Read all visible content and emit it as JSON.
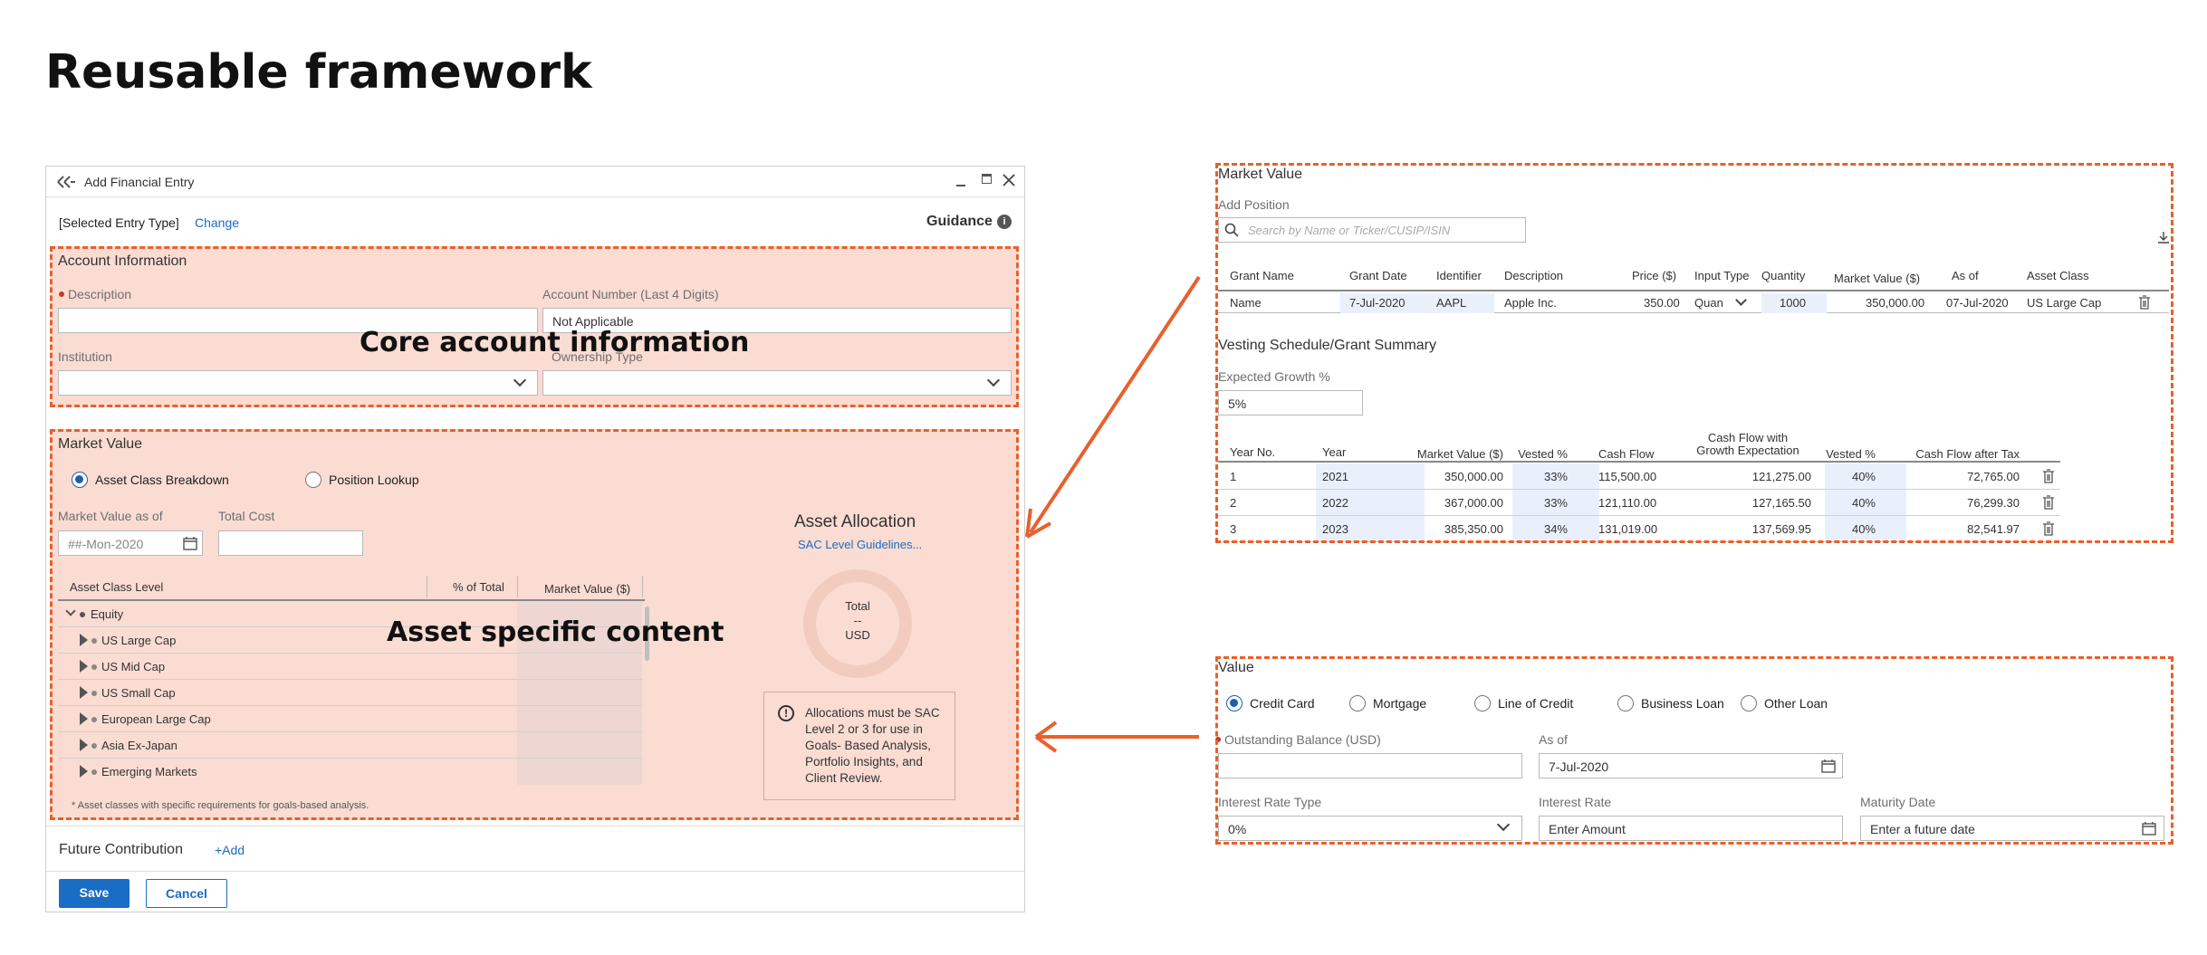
{
  "page_title": "Reusable framework",
  "dialog": {
    "title": "Add Financial Entry",
    "entry_type": "[Selected Entry Type]",
    "change_label": "Change",
    "guidance_label": "Guidance",
    "account_section_title": "Account Information",
    "description_label": "Description",
    "account_number_label": "Account Number (Last 4 Digits)",
    "account_number_value": "Not Applicable",
    "institution_label": "Institution",
    "ownership_label": "Ownership Type",
    "core_overlay": "Core account information",
    "market_section_title": "Market Value",
    "radio_asset_class": "Asset Class Breakdown",
    "radio_position": "Position Lookup",
    "market_value_as_of_label": "Market Value as of",
    "market_value_as_of_placeholder": "##-Mon-2020",
    "total_cost_label": "Total Cost",
    "col_asset_class": "Asset Class Level",
    "col_pct": "% of Total",
    "col_market": "Market Value ($)",
    "asset_rows": [
      "Equity",
      "US Large Cap",
      "US Mid Cap",
      "US Small Cap",
      "European Large Cap",
      "Asia Ex-Japan",
      "Emerging Markets"
    ],
    "asset_overlay": "Asset specific content",
    "allocation_title": "Asset Allocation",
    "allocation_link": "SAC Level Guidelines...",
    "donut_total": "Total",
    "donut_dash": "--",
    "donut_currency": "USD",
    "alert_text": "Allocations must be SAC Level 2 or 3 for use in Goals- Based Analysis, Portfolio Insights, and Client Review.",
    "footnote": "* Asset classes with specific requirements for goals-based analysis.",
    "future_contribution": "Future Contribution",
    "add_label": "+Add",
    "save": "Save",
    "cancel": "Cancel"
  },
  "market_panel": {
    "title": "Market Value",
    "add_position": "Add Position",
    "search_placeholder": "Search by Name or Ticker/CUSIP/ISIN",
    "headers": [
      "Grant Name",
      "Grant Date",
      "Identifier",
      "Description",
      "Price ($)",
      "Input Type",
      "Quantity",
      "Market Value ($)",
      "As of",
      "Asset Class"
    ],
    "row": [
      "Name",
      "7-Jul-2020",
      "AAPL",
      "Apple Inc.",
      "350.00",
      "Quan",
      "1000",
      "350,000.00",
      "07-Jul-2020",
      "US Large Cap"
    ],
    "vesting_title": "Vesting Schedule/Grant Summary",
    "growth_label": "Expected Growth %",
    "growth_value": "5%",
    "vest_headers": [
      "Year No.",
      "Year",
      "Market Value ($)",
      "Vested %",
      "Cash Flow",
      "Cash Flow with",
      "Growth Expectation",
      "Vested %",
      "Cash Flow after Tax"
    ],
    "vest_rows": [
      [
        "1",
        "2021",
        "350,000.00",
        "33%",
        "115,500.00",
        "121,275.00",
        "40%",
        "72,765.00"
      ],
      [
        "2",
        "2022",
        "367,000.00",
        "33%",
        "121,110.00",
        "127,165.50",
        "40%",
        "76,299.30"
      ],
      [
        "3",
        "2023",
        "385,350.00",
        "34%",
        "131,019.00",
        "137,569.95",
        "40%",
        "82,541.97"
      ]
    ]
  },
  "value_panel": {
    "title": "Value",
    "radios": [
      "Credit Card",
      "Mortgage",
      "Line of Credit",
      "Business Loan",
      "Other Loan"
    ],
    "outstanding_label": "Outstanding Balance (USD)",
    "as_of_label": "As of",
    "as_of_value": "7-Jul-2020",
    "rate_type_label": "Interest Rate Type",
    "rate_type_value": "0%",
    "rate_label": "Interest Rate",
    "rate_placeholder": "Enter Amount",
    "maturity_label": "Maturity Date",
    "maturity_placeholder": "Enter a future date"
  },
  "colors": {
    "accent": "#e8602c",
    "primary": "#1a6dc4",
    "highlight": "#fadcd2"
  }
}
